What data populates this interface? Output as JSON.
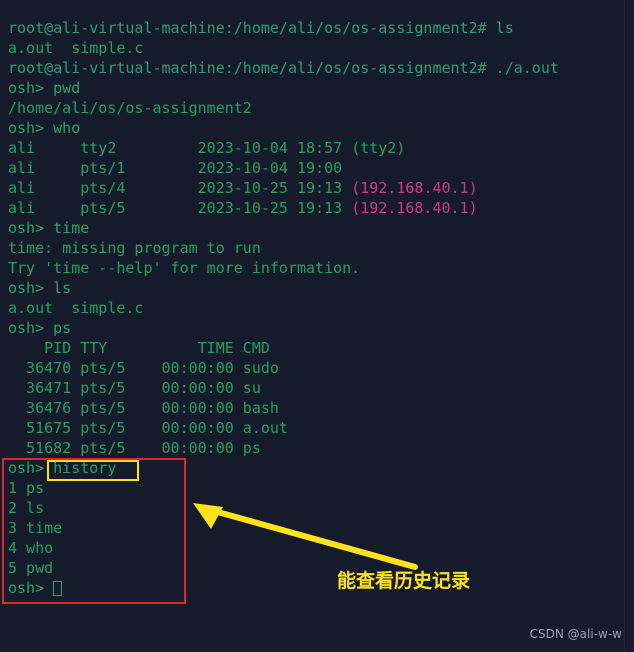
{
  "terminal": {
    "lines": [
      {
        "type": "root-prompt",
        "prompt": "root@ali-virtual-machine:/home/ali/os/os-assignment2# ",
        "command": "ls"
      },
      {
        "type": "output",
        "text": "a.out  simple.c"
      },
      {
        "type": "root-prompt",
        "prompt": "root@ali-virtual-machine:/home/ali/os/os-assignment2# ",
        "command": "./a.out"
      },
      {
        "type": "shell-prompt",
        "prompt": "osh> ",
        "command": "pwd"
      },
      {
        "type": "output",
        "text": "/home/ali/os/os-assignment2"
      },
      {
        "type": "shell-prompt",
        "prompt": "osh> ",
        "command": "who"
      },
      {
        "type": "who",
        "user": "ali",
        "tty": "tty2",
        "date": "2023-10-04 18:57",
        "from": "(tty2)",
        "from_color": "green"
      },
      {
        "type": "who",
        "user": "ali",
        "tty": "pts/1",
        "date": "2023-10-04 19:00",
        "from": "",
        "from_color": "green"
      },
      {
        "type": "who",
        "user": "ali",
        "tty": "pts/4",
        "date": "2023-10-25 19:13",
        "from": "(192.168.40.1)",
        "from_color": "magenta"
      },
      {
        "type": "who",
        "user": "ali",
        "tty": "pts/5",
        "date": "2023-10-25 19:13",
        "from": "(192.168.40.1)",
        "from_color": "magenta"
      },
      {
        "type": "shell-prompt",
        "prompt": "osh> ",
        "command": "time"
      },
      {
        "type": "output",
        "text": "time: missing program to run"
      },
      {
        "type": "output",
        "text": "Try 'time --help' for more information."
      },
      {
        "type": "shell-prompt",
        "prompt": "osh> ",
        "command": "ls"
      },
      {
        "type": "output",
        "text": "a.out  simple.c"
      },
      {
        "type": "shell-prompt",
        "prompt": "osh> ",
        "command": "ps"
      },
      {
        "type": "output",
        "text": "    PID TTY          TIME CMD"
      },
      {
        "type": "output",
        "text": "  36470 pts/5    00:00:00 sudo"
      },
      {
        "type": "output",
        "text": "  36471 pts/5    00:00:00 su"
      },
      {
        "type": "output",
        "text": "  36476 pts/5    00:00:00 bash"
      },
      {
        "type": "output",
        "text": "  51675 pts/5    00:00:00 a.out"
      },
      {
        "type": "output",
        "text": "  51682 pts/5    00:00:00 ps"
      },
      {
        "type": "shell-prompt-highlight",
        "prompt": "osh> ",
        "command": "history"
      },
      {
        "type": "output",
        "text": "1 ps"
      },
      {
        "type": "output",
        "text": "2 ls"
      },
      {
        "type": "output",
        "text": "3 time"
      },
      {
        "type": "output",
        "text": "4 who"
      },
      {
        "type": "output",
        "text": "5 pwd"
      },
      {
        "type": "shell-prompt-cursor",
        "prompt": "osh> ",
        "command": ""
      }
    ]
  },
  "annotations": {
    "note_text": "能查看历史记录",
    "note_color": "#ffe21a",
    "callout_box_color": "#e02433",
    "highlight_box_color": "#ffe21a",
    "arrow_color": "#ffe21a"
  },
  "watermark": {
    "text": "CSDN @ali-w-w"
  },
  "colors": {
    "background": "#161b2c",
    "green": "#2aa36b",
    "magenta": "#cf3a7d"
  }
}
